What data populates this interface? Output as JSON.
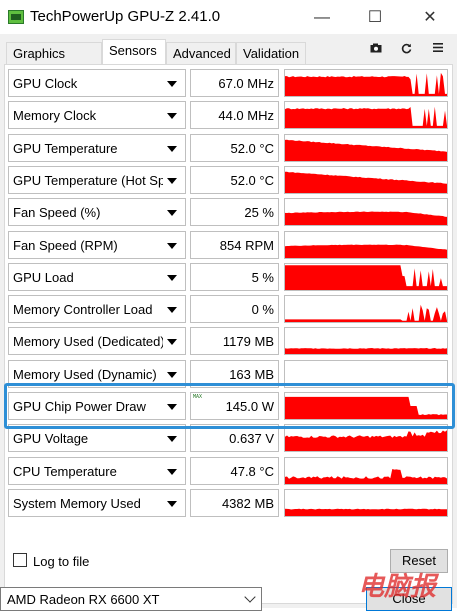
{
  "window": {
    "title": "TechPowerUp GPU-Z 2.41.0",
    "controls": {
      "minimize": "—",
      "maximize": "☐",
      "close": "✕"
    }
  },
  "tabs": [
    {
      "label": "Graphics Card",
      "active": false
    },
    {
      "label": "Sensors",
      "active": true
    },
    {
      "label": "Advanced",
      "active": false
    },
    {
      "label": "Validation",
      "active": false
    }
  ],
  "toolbar_icons": [
    "camera-icon",
    "refresh-icon",
    "menu-icon"
  ],
  "sensors": [
    {
      "name": "GPU Clock",
      "value": "67.0 MHz",
      "profile": "lowspikes",
      "level": 0.55
    },
    {
      "name": "Memory Clock",
      "value": "44.0 MHz",
      "profile": "lowspikes2",
      "level": 0.6
    },
    {
      "name": "GPU Temperature",
      "value": "52.0 °C",
      "profile": "temp",
      "level": 0.85
    },
    {
      "name": "GPU Temperature (Hot Spot)",
      "value": "52.0 °C",
      "profile": "temp",
      "level": 0.85
    },
    {
      "name": "Fan Speed (%)",
      "value": "25 %",
      "profile": "fan",
      "level": 0.55
    },
    {
      "name": "Fan Speed (RPM)",
      "value": "854 RPM",
      "profile": "fan",
      "level": 0.55
    },
    {
      "name": "GPU Load",
      "value": "5 %",
      "profile": "load",
      "level": 0.9
    },
    {
      "name": "Memory Controller Load",
      "value": "0 %",
      "profile": "mcload",
      "level": 0.35
    },
    {
      "name": "Memory Used (Dedicated)",
      "value": "1179 MB",
      "profile": "memded",
      "level": 0.3
    },
    {
      "name": "Memory Used (Dynamic)",
      "value": "163 MB",
      "profile": "empty",
      "level": 0.0
    },
    {
      "name": "GPU Chip Power Draw",
      "value": "145.0 W",
      "profile": "power",
      "level": 0.85,
      "max_tag": "MAX"
    },
    {
      "name": "GPU Voltage",
      "value": "0.637 V",
      "profile": "voltage",
      "level": 0.7
    },
    {
      "name": "CPU Temperature",
      "value": "47.8 °C",
      "profile": "cputemp",
      "level": 0.35
    },
    {
      "name": "System Memory Used",
      "value": "4382 MB",
      "profile": "sysmem",
      "level": 0.3
    }
  ],
  "log_to_file": {
    "label": "Log to file",
    "checked": false
  },
  "reset_label": "Reset",
  "close_label": "Close",
  "device_select": {
    "value": "AMD Radeon RX 6600 XT"
  },
  "watermark_text": "电脑报",
  "colors": {
    "graph": "#ff0000",
    "highlight": "#2e8fd6"
  }
}
